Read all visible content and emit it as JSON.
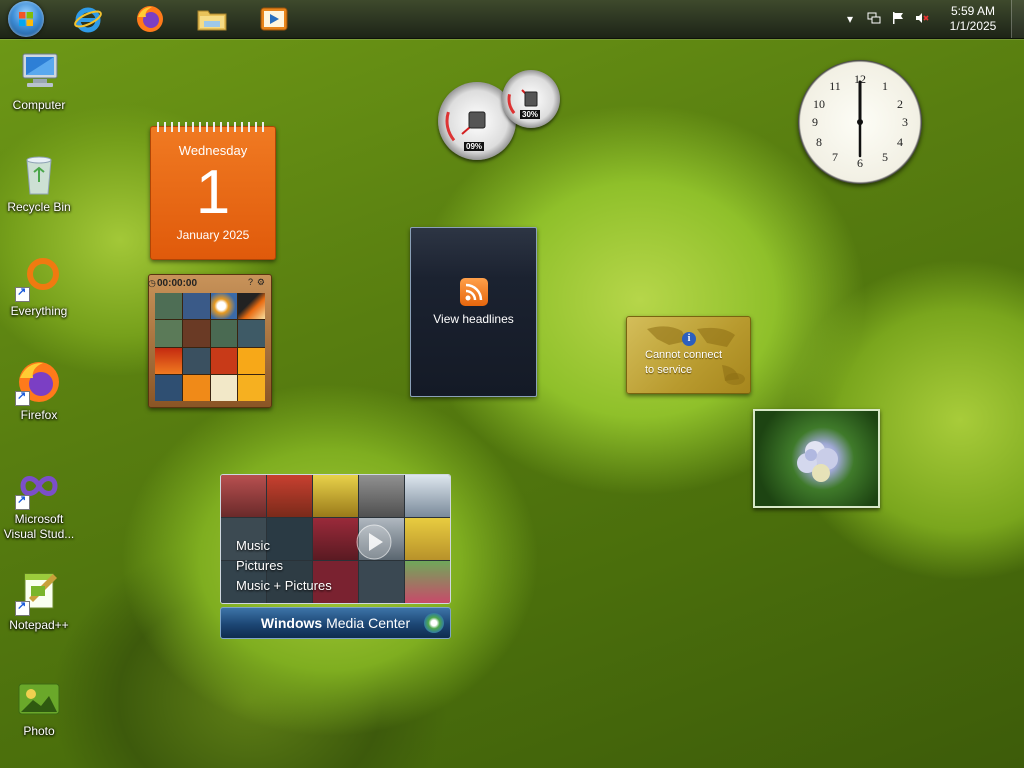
{
  "taskbar": {
    "pinned": [
      {
        "name": "internet-explorer-icon"
      },
      {
        "name": "firefox-icon"
      },
      {
        "name": "file-explorer-icon"
      },
      {
        "name": "media-player-icon"
      }
    ],
    "clock": {
      "time": "5:59 AM",
      "date": "1/1/2025"
    }
  },
  "desktop_icons": [
    {
      "label": "Computer",
      "icon": "computer-icon"
    },
    {
      "label": "Recycle Bin",
      "icon": "recycle-bin-icon"
    },
    {
      "label": "Everything",
      "icon": "everything-search-icon"
    },
    {
      "label": "Firefox",
      "icon": "firefox-icon"
    },
    {
      "label": "Microsoft Visual Stud...",
      "icon": "visual-studio-icon"
    },
    {
      "label": "Notepad++",
      "icon": "notepad-plus-plus-icon"
    },
    {
      "label": "Photo",
      "icon": "photo-app-icon"
    }
  ],
  "gadgets": {
    "calendar": {
      "weekday": "Wednesday",
      "day": "1",
      "month_year": "January 2025"
    },
    "puzzle": {
      "timer": "00:00:00"
    },
    "cpu_meter": {
      "cpu": "09%",
      "memory": "30%"
    },
    "feed": {
      "label": "View headlines"
    },
    "currency": {
      "message_line1": "Cannot connect",
      "message_line2": "to service",
      "info_glyph": "i"
    },
    "media_center": {
      "menu": [
        "Music",
        "Pictures",
        "Music + Pictures"
      ],
      "bar_label_bold": "Windows",
      "bar_label": "Media Center"
    },
    "clock": {
      "numbers": [
        "12",
        "1",
        "2",
        "3",
        "4",
        "5",
        "6",
        "7",
        "8",
        "9",
        "10",
        "11"
      ]
    }
  },
  "colors": {
    "calendar": "#e8650f",
    "taskbar": "#2a3320",
    "accent_blue": "#2b5fbd"
  }
}
